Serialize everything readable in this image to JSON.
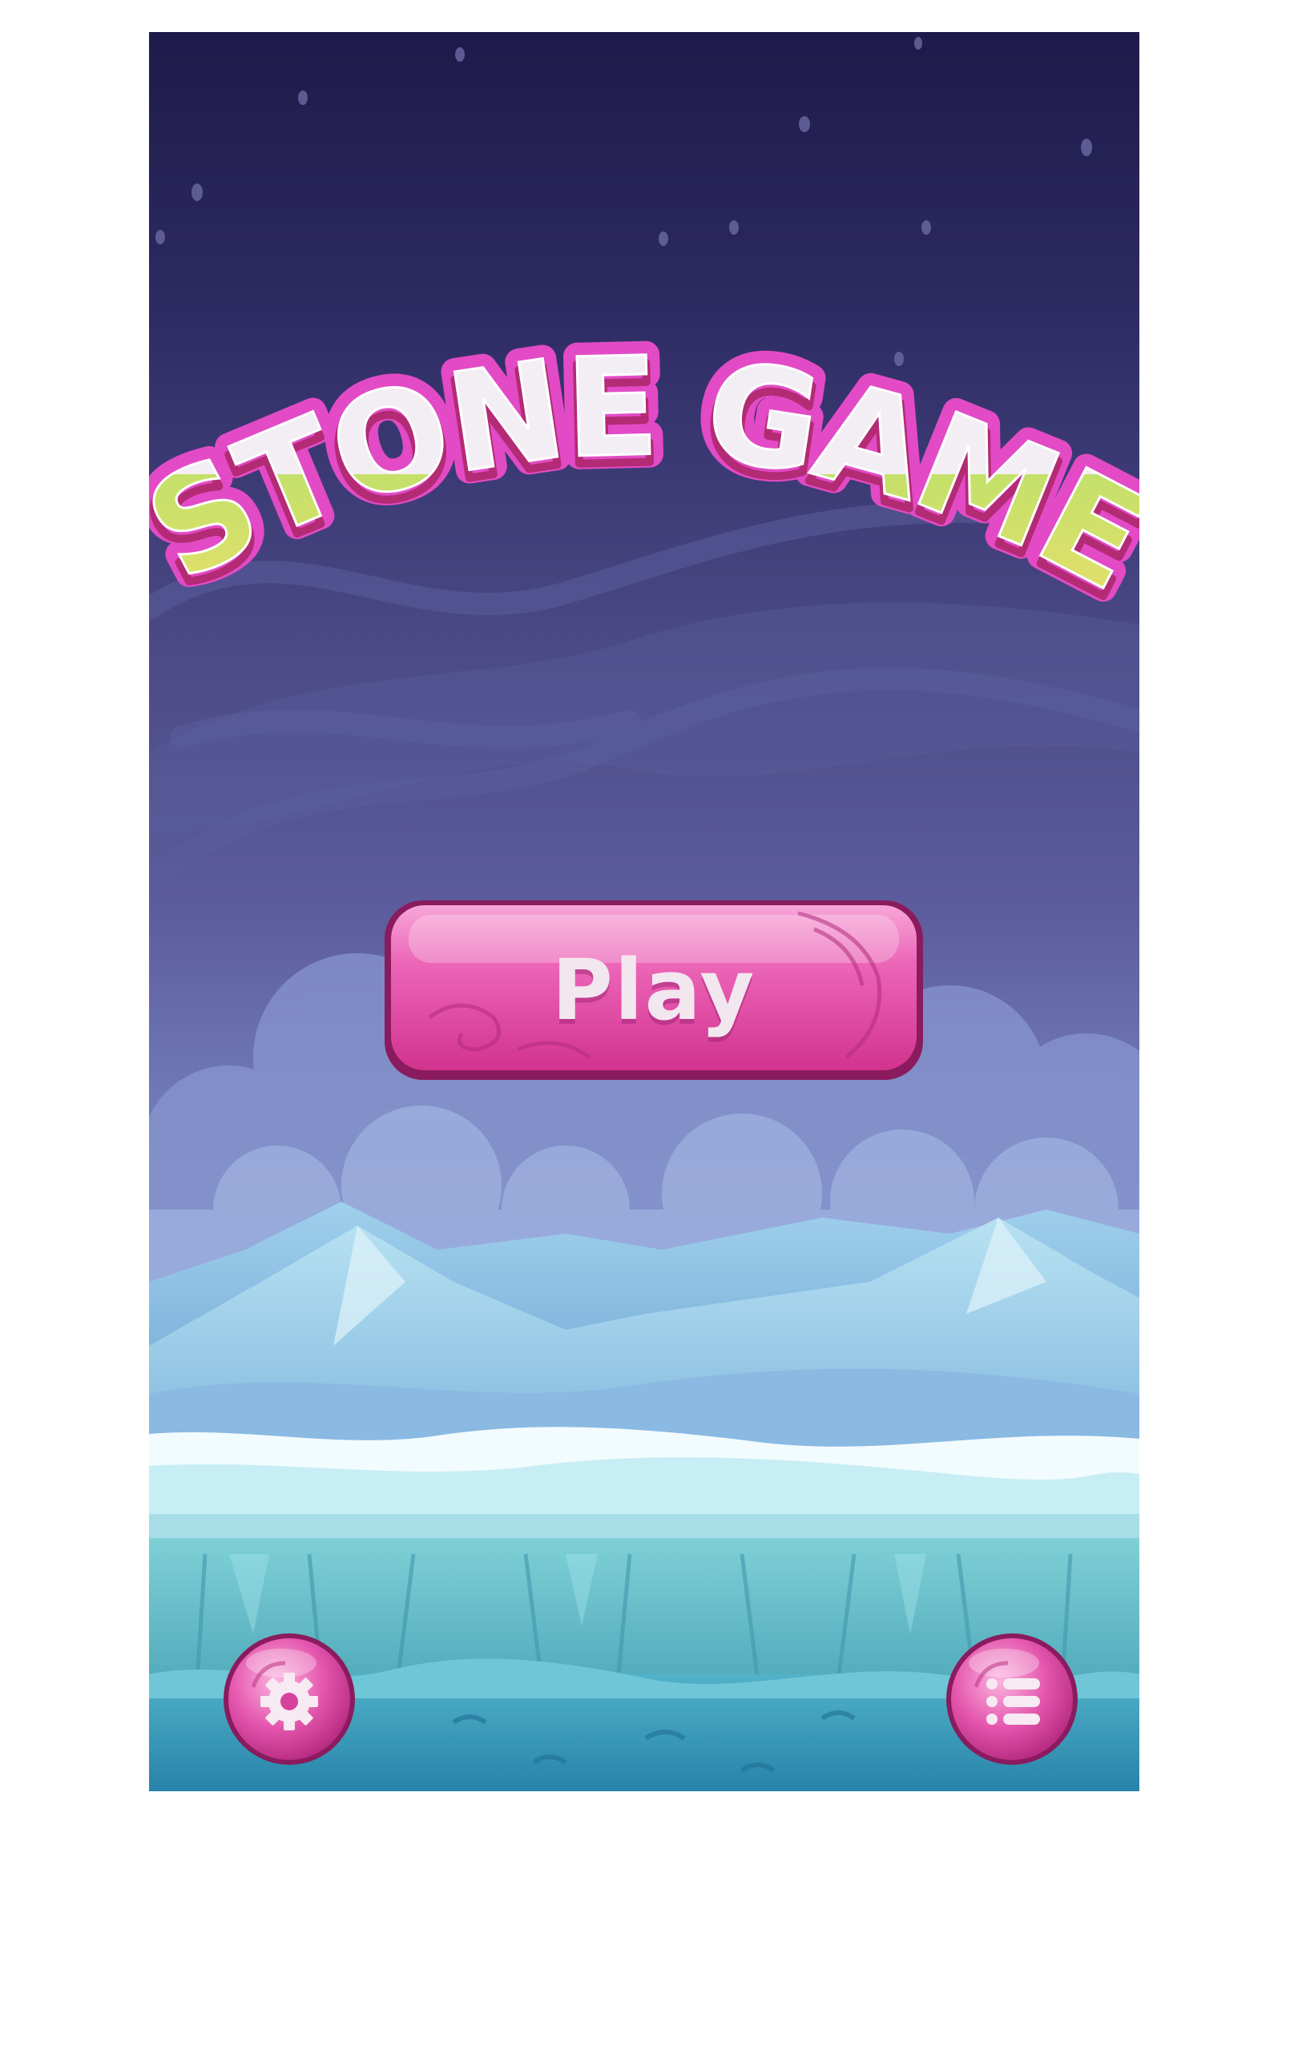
{
  "game": {
    "title": "STONE GAME",
    "play_label": "Play"
  },
  "controls": {
    "settings_icon": "gear-icon",
    "menu_icon": "list-icon"
  },
  "colors": {
    "sky_top": "#1e1a4a",
    "sky_bottom": "#8aa5d6",
    "button_pink": "#e0449a",
    "button_border": "#8a1b5e",
    "title_pink": "#e74ec8",
    "title_green": "#c6e26a",
    "ice_light": "#c8f2f6",
    "ice_mid": "#6fc3cf",
    "water_deep": "#2b8cb0"
  }
}
